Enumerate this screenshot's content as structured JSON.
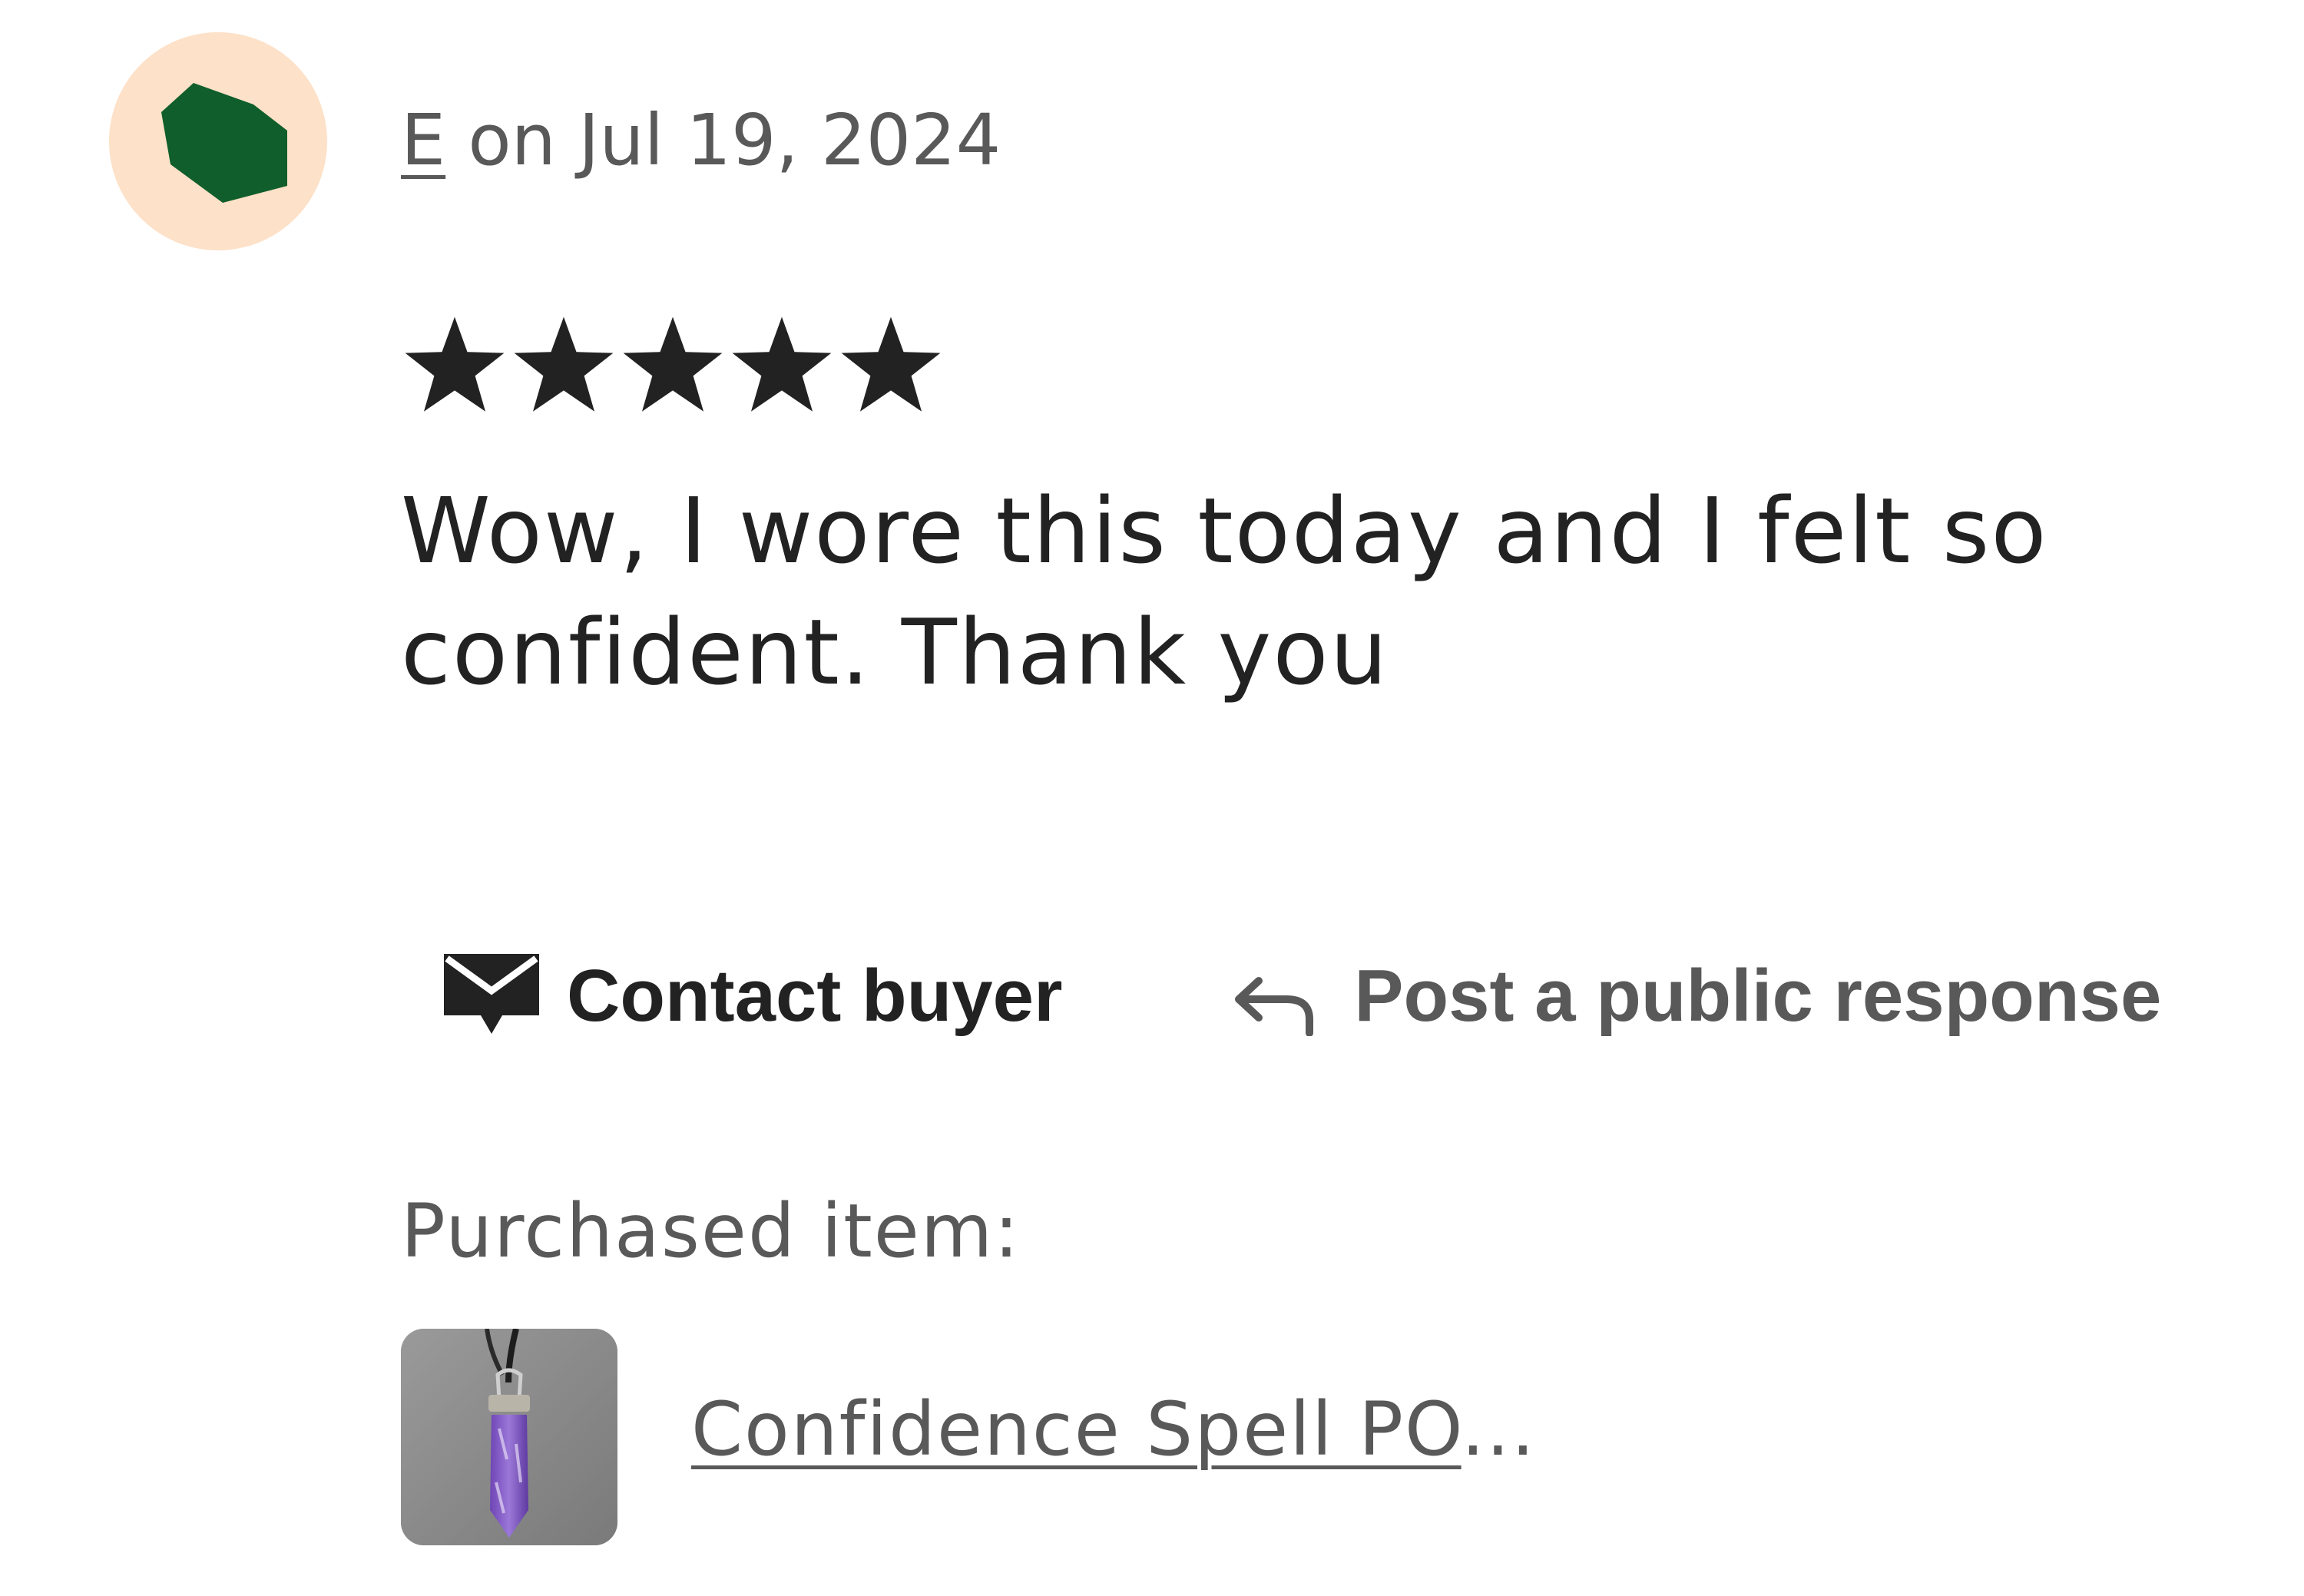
{
  "review": {
    "reviewer_name": "E",
    "date_text": "on Jul 19, 2024",
    "rating": 5,
    "rating_max": 5,
    "text": "Wow, I wore this today and I felt so confident. Thank you",
    "avatar": {
      "background_color": "#fde1c8",
      "shape_color": "#0f5e2b"
    },
    "star_color": "#222222"
  },
  "actions": {
    "contact_label": "Contact buyer",
    "contact_icon": "envelope-icon",
    "respond_label": "Post a public response",
    "respond_icon": "reply-arrow-icon"
  },
  "purchased": {
    "label": "Purchased item:",
    "item_title": "Confidence Spell PO",
    "item_ellipsis": "...",
    "thumbnail_description_icon": "amethyst-pendant-thumbnail"
  }
}
